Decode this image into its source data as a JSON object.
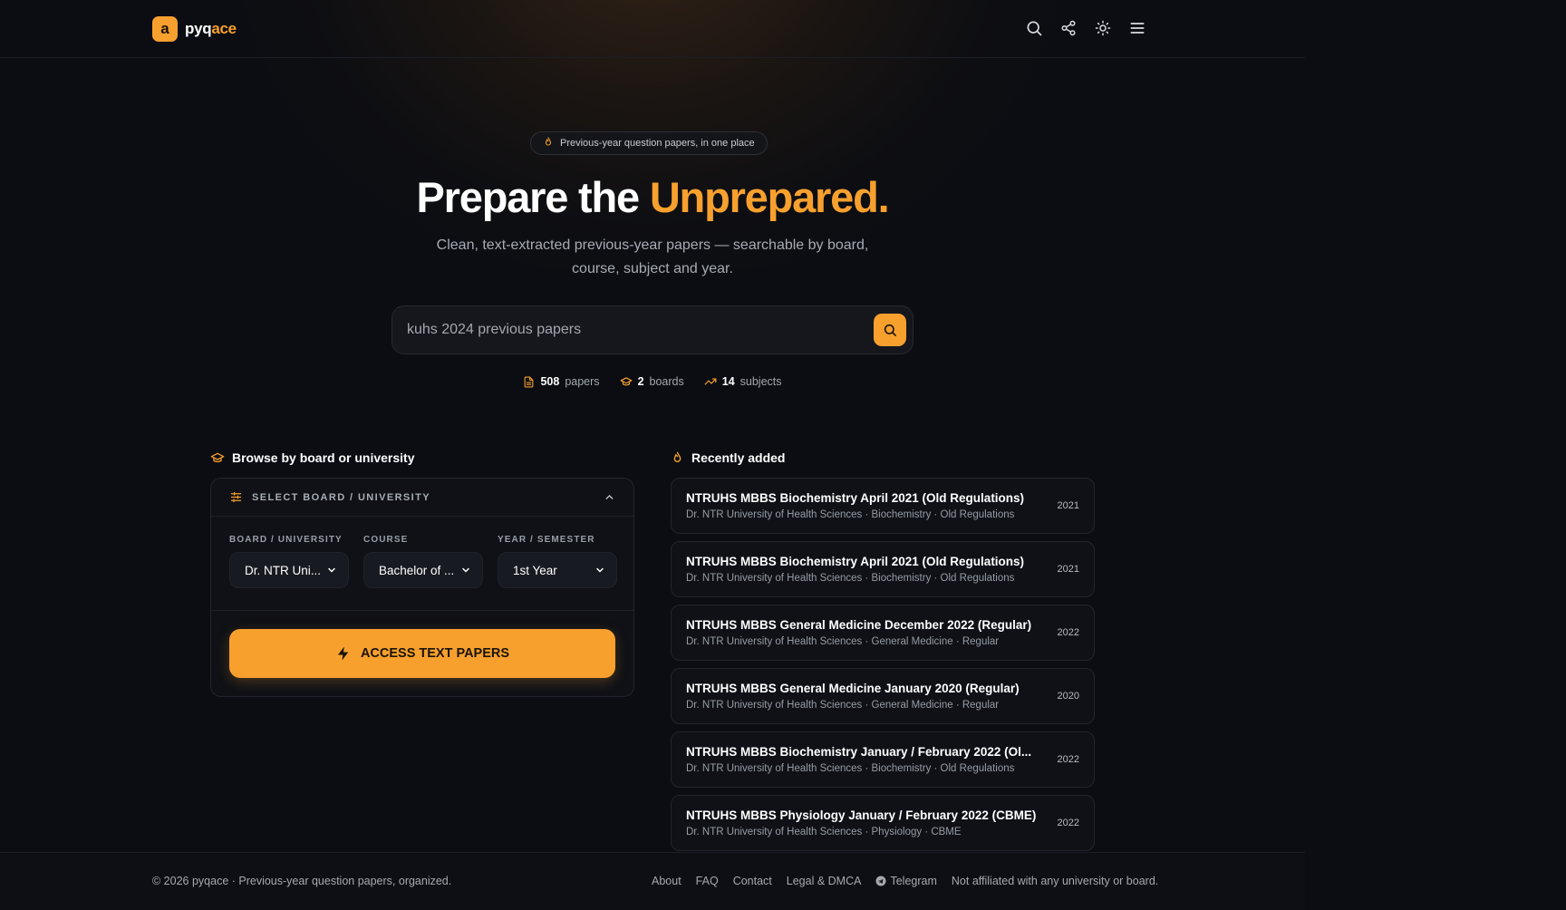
{
  "brand": {
    "logo_letter": "a",
    "name_part1": "pyq",
    "name_part2": "ace",
    "accent_color": "#f7a02e"
  },
  "header": {
    "icons": [
      "search-icon",
      "share-icon",
      "sun-icon",
      "menu-icon"
    ]
  },
  "hero": {
    "pill_text": "Previous-year question papers, in one place",
    "title_part1": "Prepare the ",
    "title_accent": "Unprepared.",
    "subtitle": "Clean, text-extracted previous-year papers — searchable by board, course, subject and year."
  },
  "search": {
    "placeholder": "kuhs 2024 previous papers"
  },
  "stats": {
    "papers_count": "508",
    "papers_label": "papers",
    "boards_count": "2",
    "boards_label": "boards",
    "subjects_count": "14",
    "subjects_label": "subjects"
  },
  "browse": {
    "heading": "Browse by board or university",
    "panel_title": "SELECT BOARD / UNIVERSITY",
    "board_label": "BOARD / UNIVERSITY",
    "board_value": "Dr. NTR Uni...",
    "course_label": "COURSE",
    "course_value": "Bachelor of ...",
    "year_label": "YEAR / SEMESTER",
    "year_value": "1st Year",
    "cta_label": "ACCESS TEXT PAPERS"
  },
  "recent": {
    "heading": "Recently added",
    "items": [
      {
        "title": "NTRUHS MBBS Biochemistry April 2021 (Old Regulations)",
        "sub": "Dr. NTR University of Health Sciences · Biochemistry · Old Regulations",
        "year": "2021"
      },
      {
        "title": "NTRUHS MBBS Biochemistry April 2021 (Old Regulations)",
        "sub": "Dr. NTR University of Health Sciences · Biochemistry · Old Regulations",
        "year": "2021"
      },
      {
        "title": "NTRUHS MBBS General Medicine December 2022 (Regular)",
        "sub": "Dr. NTR University of Health Sciences · General Medicine · Regular",
        "year": "2022"
      },
      {
        "title": "NTRUHS MBBS General Medicine January 2020 (Regular)",
        "sub": "Dr. NTR University of Health Sciences · General Medicine · Regular",
        "year": "2020"
      },
      {
        "title": "NTRUHS MBBS Biochemistry January / February 2022 (Ol...",
        "sub": "Dr. NTR University of Health Sciences · Biochemistry · Old Regulations",
        "year": "2022"
      },
      {
        "title": "NTRUHS MBBS Physiology January / February 2022 (CBME)",
        "sub": "Dr. NTR University of Health Sciences · Physiology · CBME",
        "year": "2022"
      }
    ]
  },
  "footer": {
    "copyright": "© 2026 pyqace · Previous-year question papers, organized.",
    "links": [
      "About",
      "FAQ",
      "Contact",
      "Legal & DMCA"
    ],
    "telegram": "Telegram",
    "disclaimer": "Not affiliated with any university or board."
  }
}
